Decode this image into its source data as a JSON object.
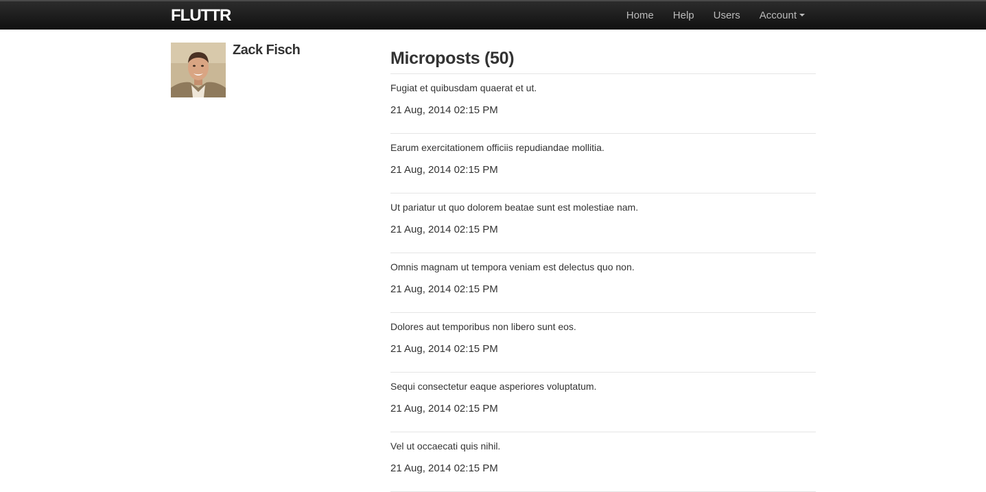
{
  "navbar": {
    "brand": "FLUTTR",
    "links": [
      "Home",
      "Help",
      "Users"
    ],
    "account": "Account"
  },
  "user": {
    "name": "Zack Fisch"
  },
  "microposts": {
    "heading": "Microposts (50)",
    "items": [
      {
        "content": "Fugiat et quibusdam quaerat et ut.",
        "timestamp": "21 Aug, 2014 02:15 PM"
      },
      {
        "content": "Earum exercitationem officiis repudiandae mollitia.",
        "timestamp": "21 Aug, 2014 02:15 PM"
      },
      {
        "content": "Ut pariatur ut quo dolorem beatae sunt est molestiae nam.",
        "timestamp": "21 Aug, 2014 02:15 PM"
      },
      {
        "content": "Omnis magnam ut tempora veniam est delectus quo non.",
        "timestamp": "21 Aug, 2014 02:15 PM"
      },
      {
        "content": "Dolores aut temporibus non libero sunt eos.",
        "timestamp": "21 Aug, 2014 02:15 PM"
      },
      {
        "content": "Sequi consectetur eaque asperiores voluptatum.",
        "timestamp": "21 Aug, 2014 02:15 PM"
      },
      {
        "content": "Vel ut occaecati quis nihil.",
        "timestamp": "21 Aug, 2014 02:15 PM"
      }
    ]
  }
}
